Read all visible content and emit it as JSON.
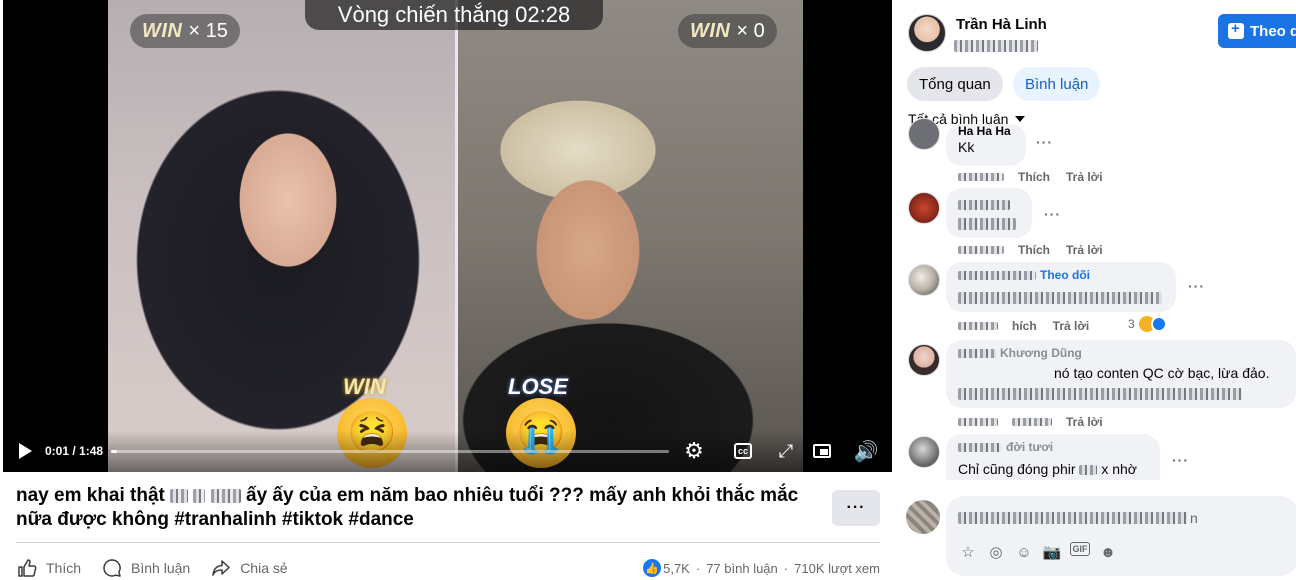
{
  "video": {
    "round_label": "Vòng chiến thắng 02:28",
    "left_badge": {
      "word": "WIN",
      "count": "× 15"
    },
    "right_badge": {
      "word": "WIN",
      "count": "× 0"
    },
    "left_result": "WIN",
    "right_result": "LOSE",
    "left_emoji": "😫",
    "right_emoji": "😭",
    "time": "0:01 / 1:48",
    "progress_fraction": 0.01
  },
  "post": {
    "caption_start": "nay em khai thật",
    "caption_end": "ấy ấy của em năm bao nhiêu tuổi ??? mấy anh khỏi thắc mắc nữa được không #tranhalinh #tiktok #dance",
    "more_label": "···",
    "actions": {
      "like": "Thích",
      "comment": "Bình luận",
      "share": "Chia sẻ"
    },
    "stats": {
      "reactions": "5,7K",
      "comments": "77 bình luận",
      "views": "710K lượt xem"
    }
  },
  "sidebar": {
    "author_name": "Trần Hà Linh",
    "follow_label": "Theo d",
    "tabs": [
      {
        "label": "Tổng quan"
      },
      {
        "label": "Bình luận"
      }
    ],
    "filter_label": "Tất cả bình luận",
    "comments": [
      {
        "name": "Ha Ha Ha",
        "text": "Kk",
        "like": "Thích",
        "reply": "Trả lời"
      },
      {
        "name": "",
        "text": "",
        "like": "Thích",
        "reply": "Trả lời"
      },
      {
        "name": "Theo dõi",
        "text": "",
        "like": "hích",
        "reply": "Trả lời",
        "reactions": "3"
      },
      {
        "name": "Khương Dũng",
        "text": "nó tạo conten QC cờ bạc, lừa đảo.",
        "like": "",
        "reply": "Trả lời"
      },
      {
        "name": "đời tươi",
        "text_start": "Chỉ cũng đóng phir",
        "text_end": "x nhờ",
        "like": "",
        "reply": ""
      }
    ],
    "compose_suffix": "n"
  },
  "colors": {
    "accent": "#1b74e4",
    "tab_active_bg": "#e7f3ff",
    "tab_active_text": "#1b5fbf"
  }
}
